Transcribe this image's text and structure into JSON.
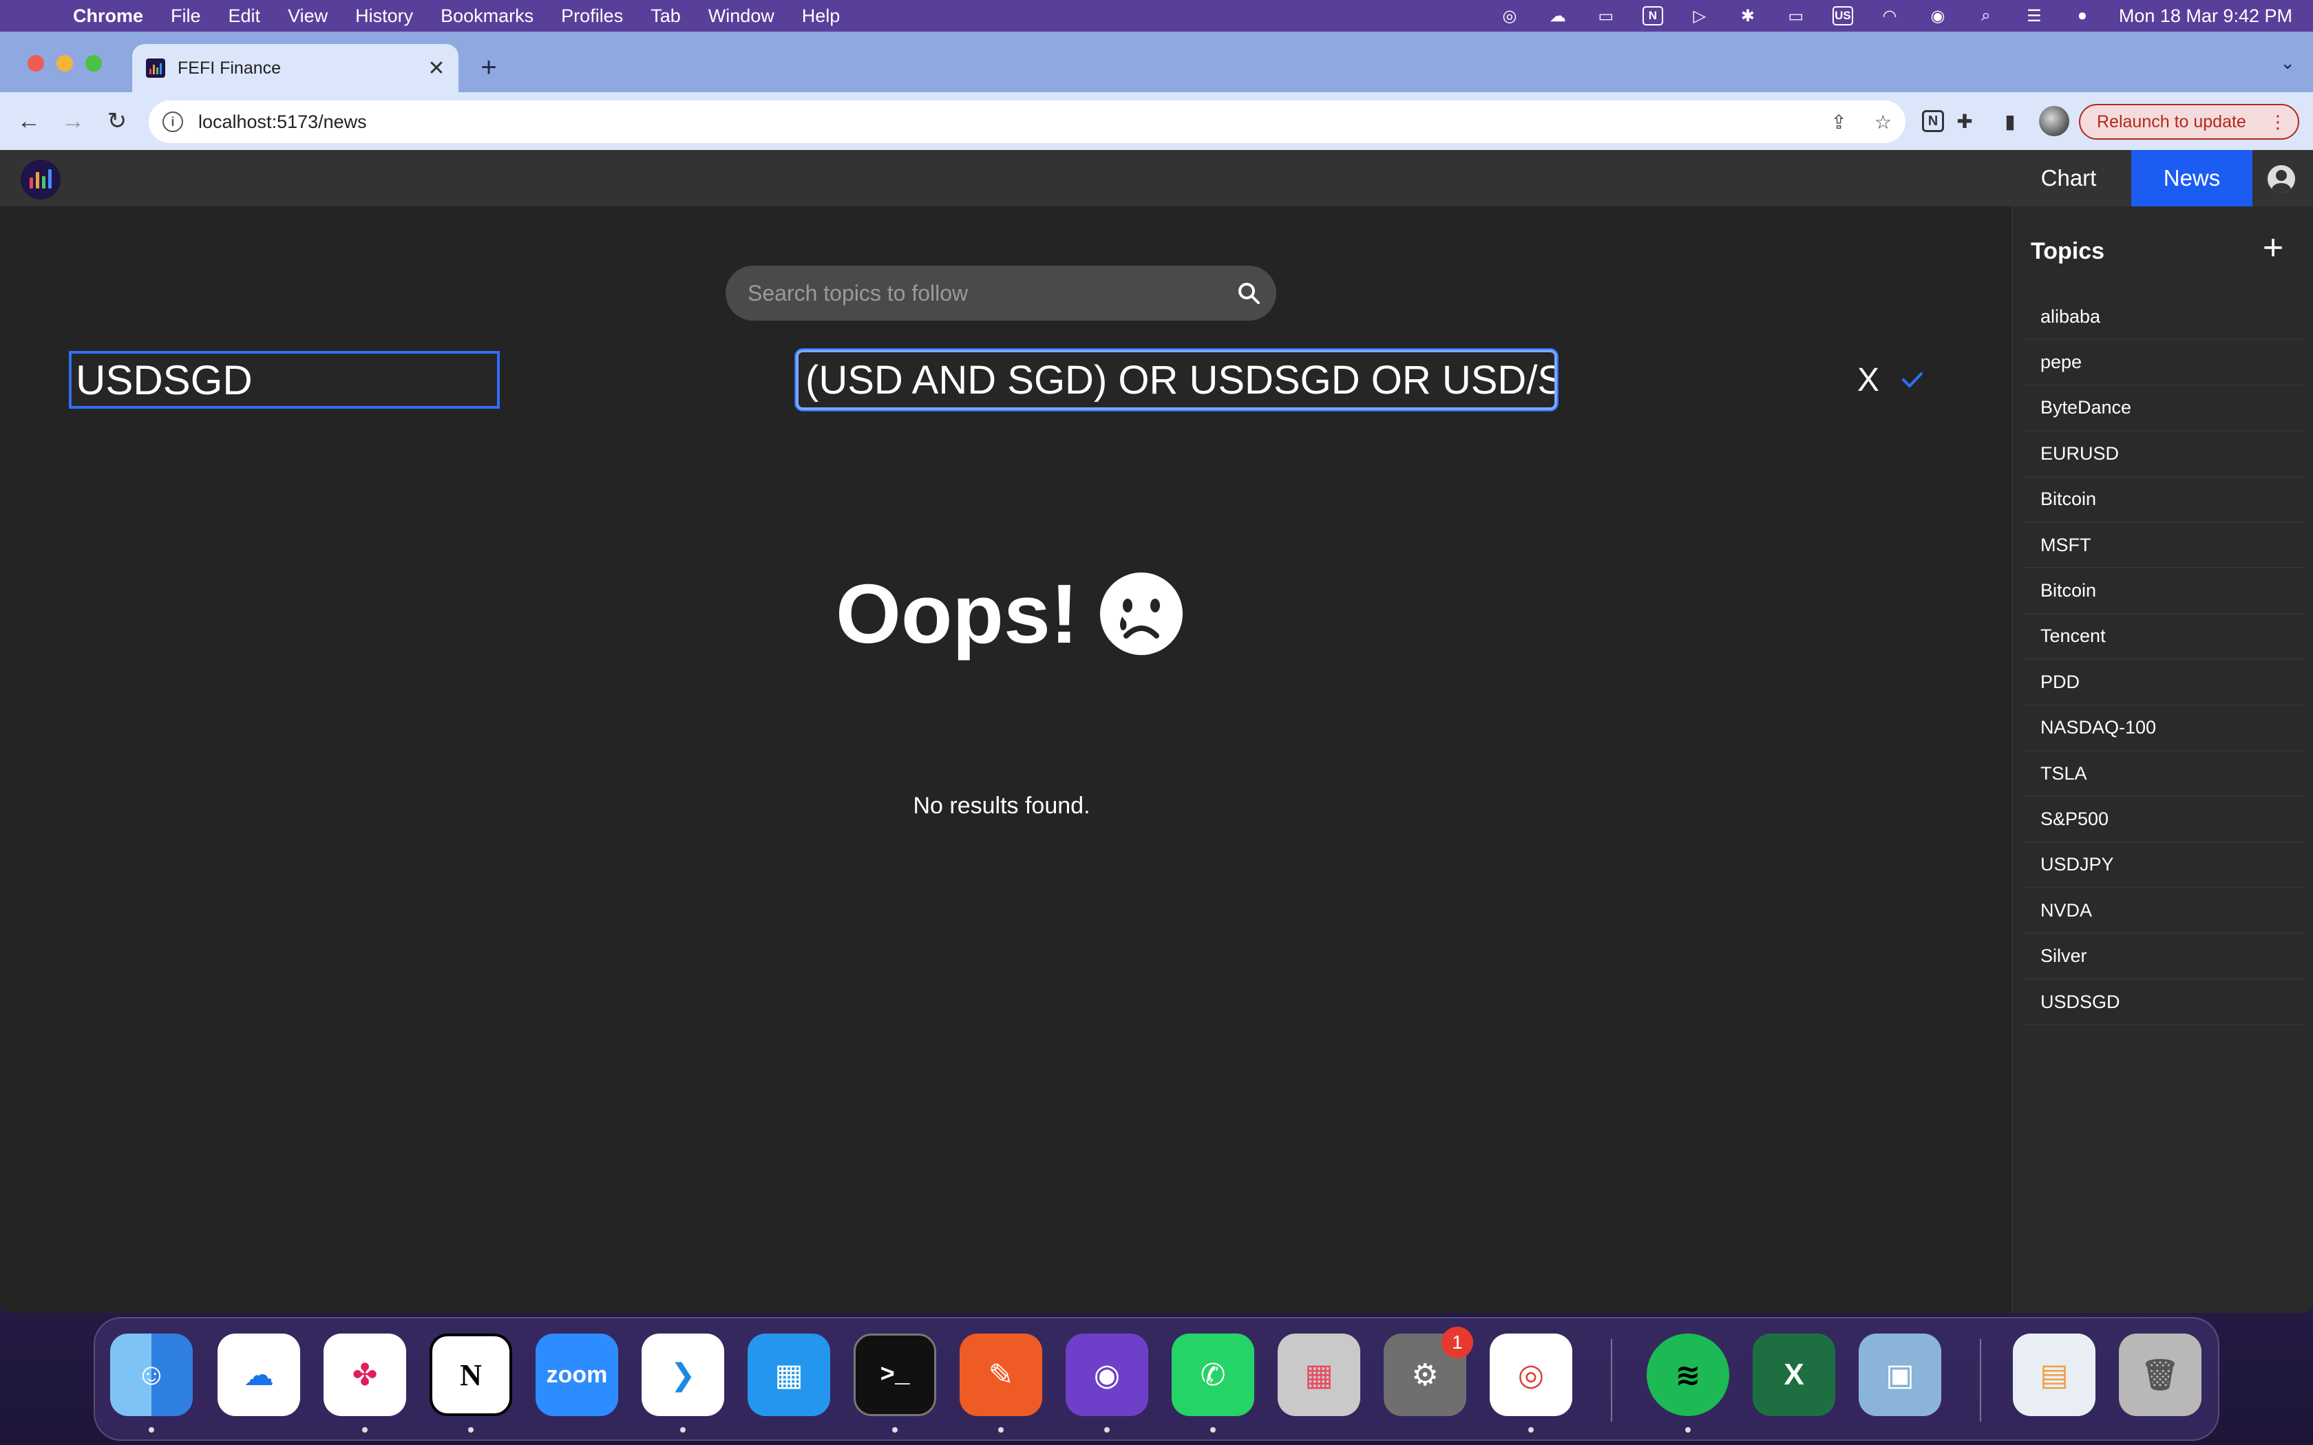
{
  "menubar": {
    "app_name": "Chrome",
    "items": [
      "File",
      "Edit",
      "View",
      "History",
      "Bookmarks",
      "Profiles",
      "Tab",
      "Window",
      "Help"
    ],
    "clock": "Mon 18 Mar  9:42 PM",
    "input_source": "US",
    "notion_glyph": "N"
  },
  "browser": {
    "tab_title": "FEFI Finance",
    "tab_close": "✕",
    "new_tab": "+",
    "url": "localhost:5173/news",
    "info_glyph": "i",
    "relaunch_label": "Relaunch to update",
    "relaunch_dots": "⋮",
    "ext_notion": "N"
  },
  "app": {
    "nav": {
      "chart": "Chart",
      "news": "News"
    },
    "search": {
      "placeholder": "Search topics to follow"
    },
    "topic_name_value": "USDSGD",
    "topic_query_value": "(USD AND SGD) OR USDSGD OR USD/S",
    "cancel_glyph": "X",
    "empty_state": {
      "title": "Oops!",
      "message": "No results found."
    },
    "sidebar": {
      "title": "Topics",
      "add_glyph": "+",
      "topics": [
        "alibaba",
        "pepe",
        "ByteDance",
        "EURUSD",
        "Bitcoin",
        "MSFT",
        "Bitcoin",
        "Tencent",
        "PDD",
        "NASDAQ-100",
        "TSLA",
        "S&P500",
        "USDJPY",
        "NVDA",
        "Silver",
        "USDSGD"
      ]
    }
  },
  "dock": {
    "zoom_label": "zoom",
    "notion_label": "N",
    "terminal_label": ">_",
    "excel_label": "X",
    "settings_badge": "1"
  },
  "colors": {
    "accent": "#1c5cf3",
    "app_bg": "#242424",
    "header_bg": "#333333",
    "input_border": "#2f6ff5"
  }
}
